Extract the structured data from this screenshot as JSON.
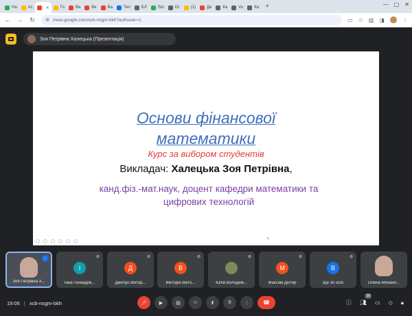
{
  "browser": {
    "tabs": [
      {
        "label": "На",
        "color": "#34a853"
      },
      {
        "label": "Ас",
        "color": "#fbbc04"
      },
      {
        "label": "",
        "color": "#ea4335",
        "active": true
      },
      {
        "label": "Го",
        "color": "#fbbc04"
      },
      {
        "label": "Ва",
        "color": "#ea4335"
      },
      {
        "label": "Ве",
        "color": "#ea4335"
      },
      {
        "label": "Ва",
        "color": "#ea4335"
      },
      {
        "label": "Тел",
        "color": "#1a73e8"
      },
      {
        "label": "БЛ",
        "color": "#5f6368"
      },
      {
        "label": "Sto",
        "color": "#34a853"
      },
      {
        "label": "Ог",
        "color": "#5f6368"
      },
      {
        "label": "(1)",
        "color": "#fbbc04"
      },
      {
        "label": "Де",
        "color": "#ea4335"
      },
      {
        "label": "Ка",
        "color": "#5f6368"
      },
      {
        "label": "Vu",
        "color": "#5f6368"
      },
      {
        "label": "Ка",
        "color": "#5f6368"
      }
    ],
    "url": "meet.google.com/xcb-nsgm-bkh?authuser=1"
  },
  "meet": {
    "presenter_label": "Зоя Петрівна Халецька (Презентація)",
    "clock": "19:06",
    "separator": "|",
    "meeting_code": "xcb-nsgm-bkh",
    "people_count": "38"
  },
  "slide": {
    "title_line1": "Основи фінансової",
    "title_line2": "математики",
    "subtitle": "Курс за вибором студентів",
    "lecturer_prefix": "Викладач: ",
    "lecturer_name": "Халецька Зоя Петрівна",
    "lecturer_suffix": ",",
    "degree_line1": "канд.фіз.-мат.наук, доцент кафедри математики та",
    "degree_line2": "цифрових технологій"
  },
  "participants": [
    {
      "name": "Зоя Петрівна Х...",
      "type": "video-self"
    },
    {
      "name": "Інна Геннадіїв...",
      "initial": "І",
      "color": "#129eaf"
    },
    {
      "name": "Дмитро Віктор...",
      "initial": "Д",
      "color": "#f4511e"
    },
    {
      "name": "Вікторія Вікто...",
      "initial": "В",
      "color": "#f4511e"
    },
    {
      "name": "Юлія Володим...",
      "initial": "",
      "color": "#7b8a5a"
    },
    {
      "name": "Максим Діхтяр",
      "initial": "М",
      "color": "#f4511e"
    },
    {
      "name": "Ще 30 осіб",
      "initial": "В",
      "color": "#1a73e8"
    },
    {
      "name": "Олена Михайл...",
      "type": "video"
    }
  ]
}
